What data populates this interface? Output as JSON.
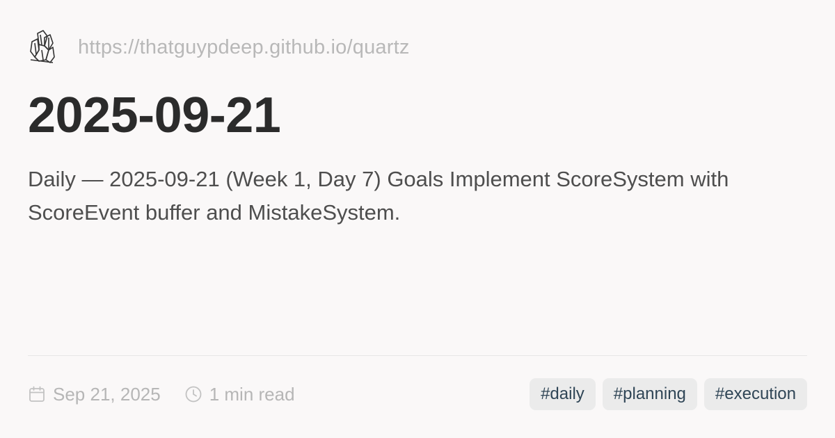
{
  "site": {
    "url": "https://thatguypdeep.github.io/quartz",
    "logo_icon": "crystal-logo-icon"
  },
  "page": {
    "title": "2025-09-21",
    "description": "Daily — 2025-09-21 (Week 1, Day 7) Goals Implement ScoreSystem with ScoreEvent buffer and MistakeSystem."
  },
  "footer": {
    "date": "Sep 21, 2025",
    "date_icon": "calendar-icon",
    "read_time": "1 min read",
    "read_time_icon": "clock-icon",
    "tags": [
      "#daily",
      "#planning",
      "#execution"
    ]
  },
  "colors": {
    "background": "#faf8f8",
    "title": "#2b2b2b",
    "muted": "#b6b6b6",
    "tag_background": "#ebebeb",
    "tag_text": "#2f4556"
  }
}
